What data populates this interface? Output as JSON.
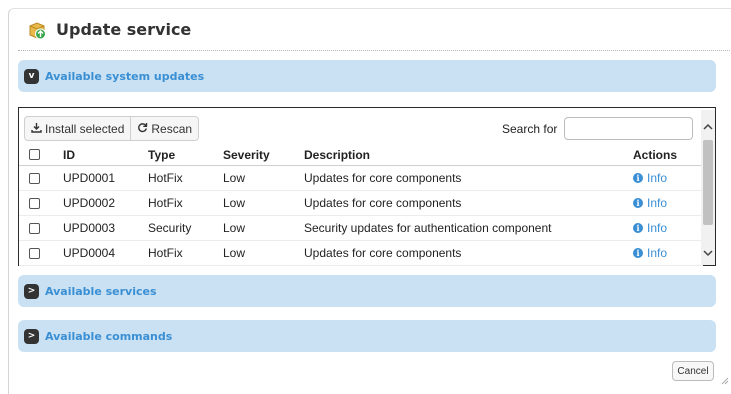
{
  "dialog": {
    "title": "Update service",
    "icon": "package-update-icon"
  },
  "sections": {
    "system_updates": {
      "label": "Available system updates",
      "toggle": "v",
      "expanded": true
    },
    "services": {
      "label": "Available services",
      "toggle": ">",
      "expanded": false
    },
    "commands": {
      "label": "Available commands",
      "toggle": ">",
      "expanded": false
    }
  },
  "toolbar": {
    "install_label": "Install selected",
    "install_icon": "download-icon",
    "rescan_label": "Rescan",
    "rescan_icon": "refresh-icon",
    "search_label": "Search for",
    "search_value": ""
  },
  "table": {
    "headers": {
      "id": "ID",
      "type": "Type",
      "severity": "Severity",
      "description": "Description",
      "actions": "Actions"
    },
    "rows": [
      {
        "id": "UPD0001",
        "type": "HotFix",
        "severity": "Low",
        "description": "Updates for core components",
        "action": "Info",
        "checked": false
      },
      {
        "id": "UPD0002",
        "type": "HotFix",
        "severity": "Low",
        "description": "Updates for core components",
        "action": "Info",
        "checked": false
      },
      {
        "id": "UPD0003",
        "type": "Security",
        "severity": "Low",
        "description": "Security updates for authentication component",
        "action": "Info",
        "checked": false
      },
      {
        "id": "UPD0004",
        "type": "HotFix",
        "severity": "Low",
        "description": "Updates for core components",
        "action": "Info",
        "checked": false
      }
    ]
  },
  "footer": {
    "cancel_label": "Cancel"
  },
  "colors": {
    "accent": "#3a8fd4",
    "section_bg": "#c9e1f2"
  }
}
